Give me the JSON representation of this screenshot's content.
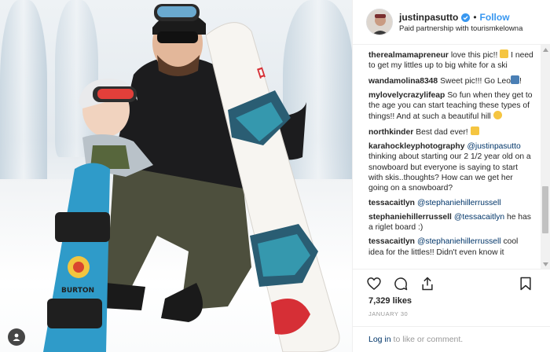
{
  "post": {
    "username": "justinpasutto",
    "follow_label": "Follow",
    "separator": "•",
    "partnership_text": "Paid partnership with tourismkelowna",
    "photo_board_brand": "BURTON"
  },
  "comments": [
    {
      "user": "therealmamapreneur",
      "text": "love this pic!!",
      "emoji": "love-eyes",
      "text2": " I need to get my littles up to big white for a ski"
    },
    {
      "user": "wandamolina8348",
      "text": "Sweet pic!!! Go Leo",
      "emoji": "snowboarder",
      "text2": "!"
    },
    {
      "user": "mylovelycrazylifeap",
      "text": "So fun when they get to the age you can start teaching these types of things!! And at such a beautiful hill",
      "emoji": "smile",
      "text2": ""
    },
    {
      "user": "northkinder",
      "text": "Best dad ever!",
      "emoji": "love-eyes",
      "text2": ""
    },
    {
      "user": "karahockleyphotography",
      "mention": "@justinpasutto",
      "text": " thinking about starting our 2 1/2 year old on a snowboard but everyone is saying to start with skis..thoughts? How can we get her going on a snowboard?"
    },
    {
      "user": "tessacaitlyn",
      "mention": "@stephaniehillerrussell",
      "text": ""
    },
    {
      "user": "stephaniehillerrussell",
      "mention": "@tessacaitlyn",
      "text": " he has a riglet board :)"
    },
    {
      "user": "tessacaitlyn",
      "mention": "@stephaniehillerrussell",
      "text": " cool idea for the littles!! Didn't even know it"
    }
  ],
  "footer": {
    "likes": "7,329 likes",
    "date": "JANUARY 30",
    "login_link": "Log in",
    "login_rest": " to like or comment."
  },
  "colors": {
    "accent": "#3897f0",
    "mention": "#003569",
    "muted": "#999999",
    "border": "#efefef"
  },
  "icons": [
    "verified-badge-icon",
    "heart-icon",
    "comment-icon",
    "share-icon",
    "bookmark-icon",
    "user-tag-icon"
  ]
}
